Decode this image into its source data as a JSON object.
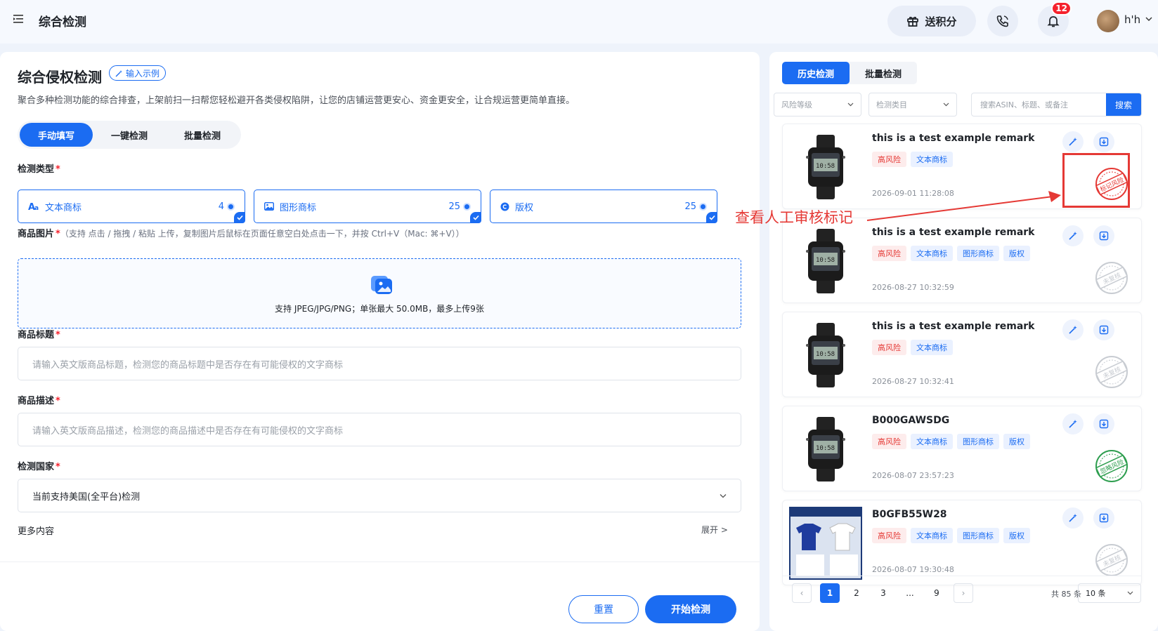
{
  "header": {
    "title": "综合检测",
    "gift_label": "送积分",
    "notification_count": "12",
    "username": "h'h"
  },
  "left": {
    "title": "综合侵权检测",
    "example_label": "输入示例",
    "description": "聚合多种检测功能的综合排查，上架前扫一扫帮您轻松避开各类侵权陷阱，让您的店铺运营更安心、资金更安全，让合规运营更简单直接。",
    "mode_tabs": [
      {
        "label": "手动填写",
        "active": true
      },
      {
        "label": "一键检测",
        "active": false
      },
      {
        "label": "批量检测",
        "active": false
      }
    ],
    "detect_type_label": "检测类型",
    "detect_types": [
      {
        "icon": "text-icon",
        "label": "文本商标",
        "count": "4"
      },
      {
        "icon": "image-icon",
        "label": "图形商标",
        "count": "25"
      },
      {
        "icon": "copyright-icon",
        "label": "版权",
        "count": "25"
      }
    ],
    "image_label": "商品图片",
    "image_hint": "（支持 点击 / 拖拽 / 粘贴 上传，复制图片后鼠标在页面任意空白处点击一下，并按 Ctrl+V（Mac: ⌘+V））",
    "upload_text": "支持 JPEG/JPG/PNG；单张最大 50.0MB，最多上传9张",
    "title_label": "商品标题",
    "title_placeholder": "请输入英文版商品标题，检测您的商品标题中是否存在有可能侵权的文字商标",
    "desc_label": "商品描述",
    "desc_placeholder": "请输入英文版商品描述，检测您的商品描述中是否存在有可能侵权的文字商标",
    "country_label": "检测国家",
    "country_value": "当前支持美国(全平台)检测",
    "more_label": "更多内容",
    "expand_label": "展开 >",
    "reset_label": "重置",
    "start_label": "开始检测"
  },
  "annotation": {
    "text": "查看人工审核标记",
    "color": "#e53935"
  },
  "right": {
    "tabs": [
      {
        "label": "历史检测",
        "active": true
      },
      {
        "label": "批量检测",
        "active": false
      }
    ],
    "risk_filter": "风险等级",
    "category_filter": "检测类目",
    "search_placeholder": "搜索ASIN、标题、或备注",
    "search_label": "搜索",
    "cards": [
      {
        "title": "this is a test example remark",
        "tags": [
          "高风险",
          "文本商标"
        ],
        "date": "2026-09-01 11:28:08",
        "stamp": "标记风险",
        "stamp_color": "#e53935",
        "thumb": "watch"
      },
      {
        "title": "this is a test example remark",
        "tags": [
          "高风险",
          "文本商标",
          "图形商标",
          "版权"
        ],
        "date": "2026-08-27 10:32:59",
        "stamp": "未复核",
        "stamp_color": "#c8ccd2",
        "thumb": "watch"
      },
      {
        "title": "this is a test example remark",
        "tags": [
          "高风险",
          "文本商标"
        ],
        "date": "2026-08-27 10:32:41",
        "stamp": "未复核",
        "stamp_color": "#c8ccd2",
        "thumb": "watch"
      },
      {
        "title": "B000GAWSDG",
        "tags": [
          "高风险",
          "文本商标",
          "图形商标",
          "版权"
        ],
        "date": "2026-08-07 23:57:23",
        "stamp": "忽略风险",
        "stamp_color": "#2e9e4f",
        "thumb": "watch"
      },
      {
        "title": "B0GFB55W28",
        "tags": [
          "高风险",
          "文本商标",
          "图形商标",
          "版权"
        ],
        "date": "2026-08-07 19:30:48",
        "stamp": "未复核",
        "stamp_color": "#c8ccd2",
        "thumb": "tshirt"
      }
    ],
    "pager": {
      "pages": [
        "1",
        "2",
        "3",
        "...",
        "9"
      ],
      "current": "1",
      "total": "共 85 条",
      "page_size": "10 条"
    }
  },
  "colors": {
    "primary": "#1b6cf2",
    "danger": "#f5222d"
  }
}
